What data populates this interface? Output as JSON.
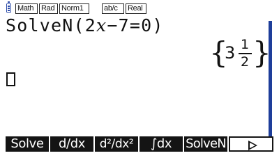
{
  "status_bar": {
    "battery_icon": "battery-icon",
    "indicators": {
      "math": "Math",
      "angle": "Rad",
      "display": "Norm1",
      "fraction": "ab/c",
      "complex": "Real"
    }
  },
  "expression": {
    "func": "SolveN(2",
    "var": "x",
    "rest": "−7=0)"
  },
  "result": {
    "brace_left": "{",
    "whole": "3",
    "numerator": "1",
    "denominator": "2",
    "brace_right": "}"
  },
  "function_keys": {
    "f1": "Solve",
    "f2": "d/dx",
    "f3": "d²/dx²",
    "f4": "∫dx",
    "f5": "SolveN",
    "f6": "next-menu-icon"
  },
  "colors": {
    "accent": "#1e3e9a",
    "fkey_bg": "#141414"
  }
}
